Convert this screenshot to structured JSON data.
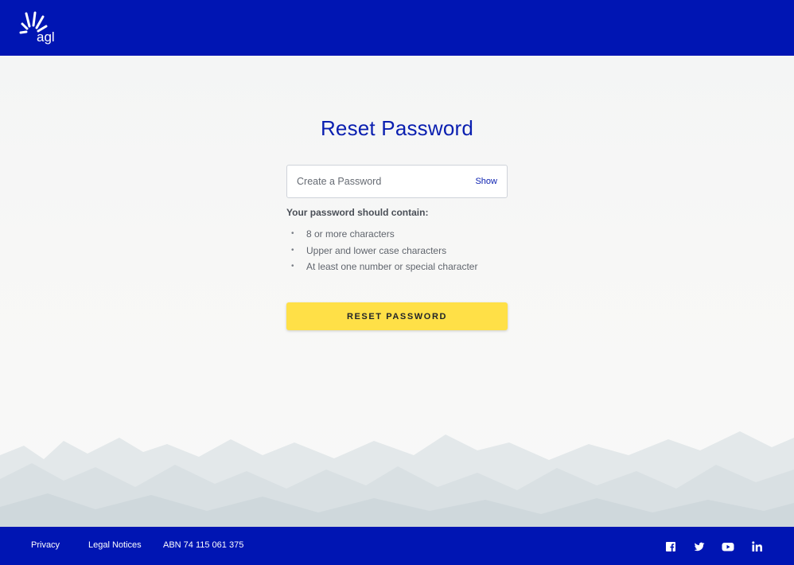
{
  "header": {
    "brand": "agl",
    "brand_color": "#0015b3"
  },
  "main": {
    "title": "Reset Password",
    "password_field": {
      "placeholder": "Create a Password",
      "value": "",
      "show_label": "Show"
    },
    "requirements": {
      "heading": "Your password should contain:",
      "bullet": "•",
      "items": [
        "8 or more characters",
        "Upper and lower case characters",
        "At least one number or special character"
      ]
    },
    "submit_label": "RESET PASSWORD",
    "submit_color": "#ffe047",
    "title_color": "#0a1fb0"
  },
  "footer": {
    "links": [
      "Privacy",
      "Legal Notices"
    ],
    "abn": "ABN 74 115 061 375",
    "social_icons": [
      "facebook-icon",
      "twitter-icon",
      "youtube-icon",
      "linkedin-icon"
    ]
  }
}
